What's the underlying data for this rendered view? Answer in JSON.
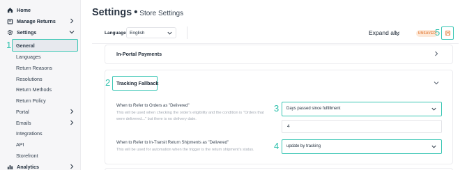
{
  "sidebar": {
    "top_items": [
      {
        "label": "Home",
        "icon": "home-icon"
      },
      {
        "label": "Manage Returns",
        "icon": "returns-icon"
      },
      {
        "label": "Settings",
        "icon": "gear-icon"
      }
    ],
    "settings_items": [
      {
        "label": "General"
      },
      {
        "label": "Languages"
      },
      {
        "label": "Return Reasons"
      },
      {
        "label": "Resolutions"
      },
      {
        "label": "Return Methods"
      },
      {
        "label": "Return Policy"
      },
      {
        "label": "Portal"
      },
      {
        "label": "Emails"
      },
      {
        "label": "Integrations"
      },
      {
        "label": "API"
      },
      {
        "label": "Storefront"
      }
    ],
    "analytics": {
      "label": "Analytics",
      "icon": "analytics-icon"
    }
  },
  "header": {
    "title": "Settings",
    "separator": "•",
    "subtitle": "Store Settings"
  },
  "toolbar": {
    "language_label": "Language",
    "language_value": "English",
    "expand_all": "Expand all",
    "unsaved_badge": "UNSAVED",
    "save_icon": "save-icon"
  },
  "sections": {
    "in_portal_payments": "In-Portal Payments",
    "tracking_fallback": "Tracking Fallback"
  },
  "tracking": {
    "orders_label": "When to Refer to Orders as \"Delivered\"",
    "orders_help": "This will be used when checking the order's eligibility and the condition is \"Orders that were delivered...\" but there is no delivery date.",
    "orders_value": "Days passed since fulfillment",
    "days_value": "4",
    "shipments_label": "When to Refer to In-Transit Return Shipments as \"Delivered\"",
    "shipments_help": "This will be used for automation when the trigger is the return shipment's status.",
    "shipments_value": "update by tracking"
  },
  "annotations": [
    "1",
    "2",
    "3",
    "4",
    "5"
  ],
  "colors": {
    "annotation": "#39c6b4",
    "unsaved_bg": "#fde9d9",
    "unsaved_text": "#e7884a",
    "sidebar_bg": "#f6f6f8"
  }
}
